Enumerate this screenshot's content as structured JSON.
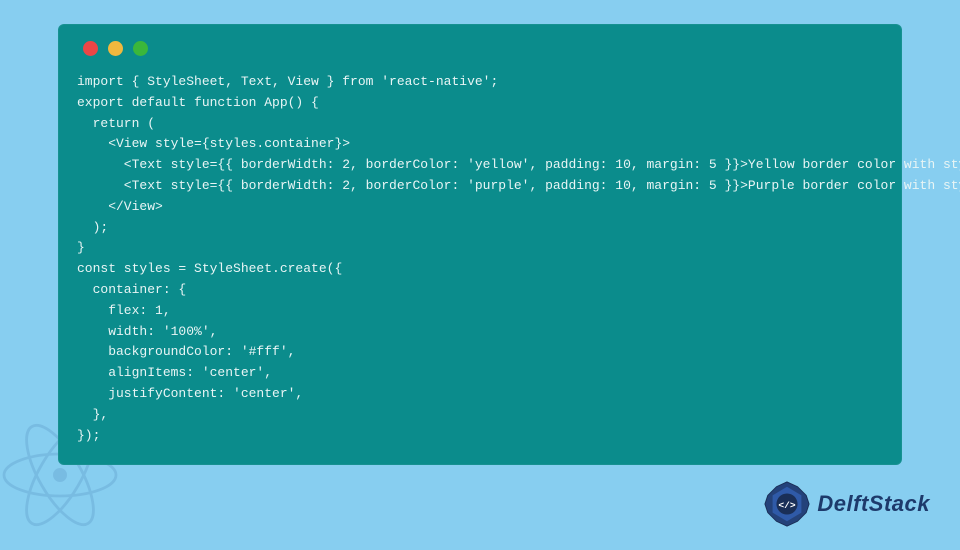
{
  "code": {
    "lines": [
      "import { StyleSheet, Text, View } from 'react-native';",
      "export default function App() {",
      "  return (",
      "    <View style={styles.container}>",
      "      <Text style={{ borderWidth: 2, borderColor: 'yellow', padding: 10, margin: 5 }}>Yellow border color with style prop</Text>",
      "      <Text style={{ borderWidth: 2, borderColor: 'purple', padding: 10, margin: 5 }}>Purple border color with style prop</Text>",
      "    </View>",
      "  );",
      "}",
      "const styles = StyleSheet.create({",
      "  container: {",
      "    flex: 1,",
      "    width: '100%',",
      "    backgroundColor: '#fff',",
      "    alignItems: 'center',",
      "    justifyContent: 'center',",
      "  },",
      "});"
    ]
  },
  "branding": {
    "name": "DelftStack"
  }
}
